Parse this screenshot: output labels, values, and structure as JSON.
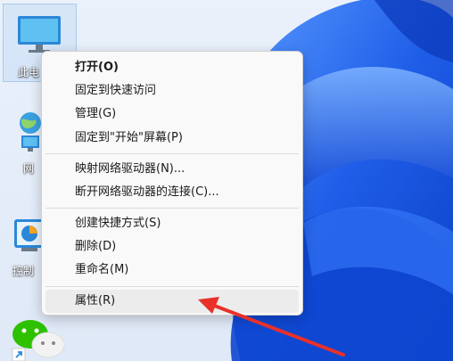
{
  "desktop": {
    "icons": [
      {
        "label": "此电",
        "icon": "computer-icon"
      },
      {
        "label": "网",
        "icon": "network-icon"
      },
      {
        "label": "控制",
        "icon": "control-panel-icon"
      },
      {
        "label": "",
        "icon": "wechat-icon"
      }
    ]
  },
  "context_menu": {
    "items": [
      {
        "label": "打开(O)"
      },
      {
        "label": "固定到快速访问"
      },
      {
        "label": "管理(G)"
      },
      {
        "label": "固定到\"开始\"屏幕(P)"
      },
      {
        "label": "映射网络驱动器(N)..."
      },
      {
        "label": "断开网络驱动器的连接(C)..."
      },
      {
        "label": "创建快捷方式(S)"
      },
      {
        "label": "删除(D)"
      },
      {
        "label": "重命名(M)"
      },
      {
        "label": "属性(R)"
      }
    ]
  },
  "colors": {
    "wallpaper_blue": "#1f5ee8",
    "annotation_arrow": "#e8312a"
  }
}
